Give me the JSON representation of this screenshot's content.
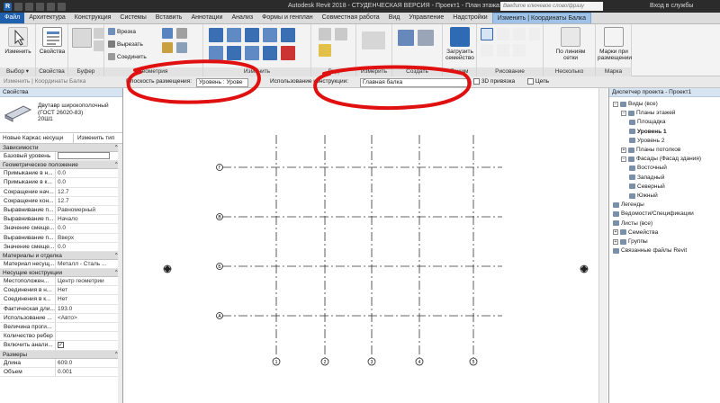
{
  "titlebar": {
    "title": "Autodesk Revit 2018 - СТУДЕНЧЕСКАЯ ВЕРСИЯ -   Проект1 - План этажа: Уровень 1",
    "search_placeholder": "Введите ключевое слово/фразу",
    "user": "Вход в службы"
  },
  "tabs": [
    {
      "label": "Файл"
    },
    {
      "label": "Архитектура"
    },
    {
      "label": "Конструкция"
    },
    {
      "label": "Системы"
    },
    {
      "label": "Вставить"
    },
    {
      "label": "Аннотации"
    },
    {
      "label": "Анализ"
    },
    {
      "label": "Формы и генплан"
    },
    {
      "label": "Совместная работа"
    },
    {
      "label": "Вид"
    },
    {
      "label": "Управление"
    },
    {
      "label": "Надстройки"
    },
    {
      "label": "Изменить | Координаты Балка"
    }
  ],
  "ribbon": {
    "modify_label": "Изменить",
    "select_label": "Выбор ▾",
    "properties_label": "Свойства",
    "clipboard_label": "Буфер обмена",
    "cut_label": "Врезка",
    "cut_out_label": "Вырезать",
    "join_label": "Соединить",
    "geometry_label": "Геометрия",
    "modify_panel_label": "Изменить",
    "view_panel_label": "Вид",
    "measure_label": "Измерить",
    "create_label": "Создать",
    "load_family_label": "Загрузить семейство",
    "mode_label": "Режим",
    "draw_label": "Рисование",
    "by_grid_label": "По линиям сетки",
    "multiple_label": "Несколько",
    "tags_label": "Марки при размещении",
    "tag_panel_label": "Марка"
  },
  "optbar": {
    "hint": "Изменить | Координаты Балка",
    "placement_plane_label": "Плоскость размещения:",
    "placement_plane_value": "Уровень : Урове",
    "usage_label": "Использование конструкции:",
    "usage_value": "Главная балка",
    "snap_3d_label": "3D привязка",
    "chain_label": "Цепь"
  },
  "properties": {
    "header": "Свойства",
    "type_name_1": "Двутавр широкополочный",
    "type_name_2": "(ГОСТ 26020-83)",
    "type_name_3": "20Ш1",
    "type_selector": "Новые Каркас несущи",
    "edit_type": "Изменить тип",
    "groups": [
      {
        "label": "Зависимости",
        "rows": [
          {
            "name": "Базовый уровень",
            "value": ""
          }
        ]
      },
      {
        "label": "Геометрическое положение",
        "rows": [
          {
            "name": "Примыкание в н...",
            "value": "0.0"
          },
          {
            "name": "Примыкание в к...",
            "value": "0.0"
          },
          {
            "name": "Сокращение нач...",
            "value": "12.7"
          },
          {
            "name": "Сокращение кон...",
            "value": "12.7"
          },
          {
            "name": "Выравнивание п...",
            "value": "Равномерный"
          },
          {
            "name": "Выравнивание п...",
            "value": "Начало"
          },
          {
            "name": "Значение смеще...",
            "value": "0.0"
          },
          {
            "name": "Выравнивание п...",
            "value": "Вверх"
          },
          {
            "name": "Значение смеще...",
            "value": "0.0"
          }
        ]
      },
      {
        "label": "Материалы и отделка",
        "rows": [
          {
            "name": "Материал несущ...",
            "value": "Металл - Сталь ..."
          }
        ]
      },
      {
        "label": "Несущие конструкции",
        "rows": [
          {
            "name": "Местоположен...",
            "value": "Центр геометрии"
          },
          {
            "name": "Соединения в н...",
            "value": "Нет"
          },
          {
            "name": "Соединения в к...",
            "value": "Нет"
          },
          {
            "name": "Фактическая дли...",
            "value": "193.0"
          },
          {
            "name": "Использование ...",
            "value": "<Авто>"
          },
          {
            "name": "Величина проги...",
            "value": ""
          },
          {
            "name": "Количество ребер",
            "value": ""
          },
          {
            "name": "Включить анали...",
            "value": "✓"
          }
        ]
      },
      {
        "label": "Размеры",
        "rows": [
          {
            "name": "Длина",
            "value": "609.0"
          },
          {
            "name": "Объем",
            "value": "0.001"
          }
        ]
      }
    ]
  },
  "browser": {
    "header": "Диспетчер проекта - Проект1",
    "nodes": [
      {
        "label": "Виды (все)",
        "depth": 0,
        "toggle": "−",
        "bold": false
      },
      {
        "label": "Планы этажей",
        "depth": 1,
        "toggle": "−",
        "bold": false
      },
      {
        "label": "Площадка",
        "depth": 2,
        "toggle": "",
        "bold": false
      },
      {
        "label": "Уровень 1",
        "depth": 2,
        "toggle": "",
        "bold": true
      },
      {
        "label": "Уровень 2",
        "depth": 2,
        "toggle": "",
        "bold": false
      },
      {
        "label": "Планы потолков",
        "depth": 1,
        "toggle": "+",
        "bold": false
      },
      {
        "label": "Фасады (Фасад здания)",
        "depth": 1,
        "toggle": "−",
        "bold": false
      },
      {
        "label": "Восточный",
        "depth": 2,
        "toggle": "",
        "bold": false
      },
      {
        "label": "Западный",
        "depth": 2,
        "toggle": "",
        "bold": false
      },
      {
        "label": "Северный",
        "depth": 2,
        "toggle": "",
        "bold": false
      },
      {
        "label": "Южный",
        "depth": 2,
        "toggle": "",
        "bold": false
      },
      {
        "label": "Легенды",
        "depth": 0,
        "toggle": "",
        "bold": false
      },
      {
        "label": "Ведомости/Спецификации",
        "depth": 0,
        "toggle": "",
        "bold": false
      },
      {
        "label": "Листы (все)",
        "depth": 0,
        "toggle": "",
        "bold": false
      },
      {
        "label": "Семейства",
        "depth": 0,
        "toggle": "+",
        "bold": false
      },
      {
        "label": "Группы",
        "depth": 0,
        "toggle": "+",
        "bold": false
      },
      {
        "label": "Связанные файлы Revit",
        "depth": 0,
        "toggle": "",
        "bold": false
      }
    ]
  },
  "canvas": {
    "row_markers": [
      "Г",
      "В",
      "Б",
      "А"
    ],
    "col_markers": [
      "1",
      "2",
      "3",
      "4",
      "5"
    ]
  },
  "colors": {
    "accent": "#1e5fae",
    "active_tab": "#9fc3e8",
    "annotation_red": "#e01010"
  }
}
